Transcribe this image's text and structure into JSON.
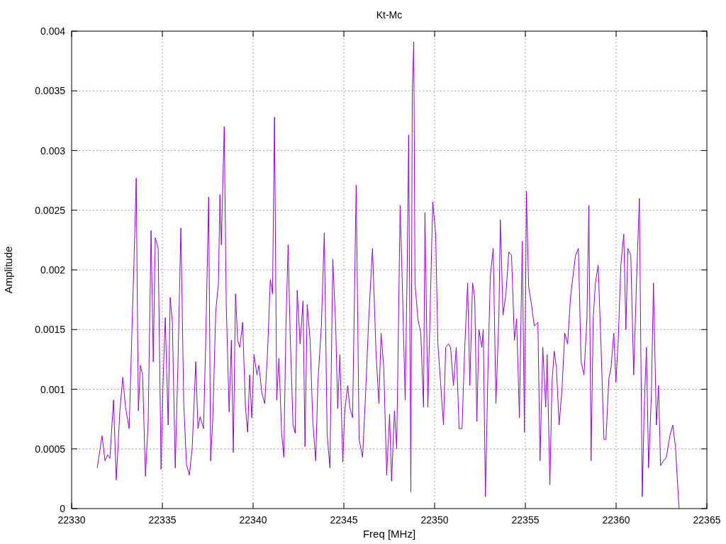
{
  "chart_data": {
    "type": "line",
    "title": "Kt-Mc",
    "xlabel": "Freq [MHz]",
    "ylabel": "Amplitude",
    "grid": true,
    "xlim": [
      22330,
      22365
    ],
    "ylim": [
      0,
      0.004
    ],
    "xticks": [
      22330,
      22335,
      22340,
      22345,
      22350,
      22355,
      22360,
      22365
    ],
    "yticks": [
      0,
      0.0005,
      0.001,
      0.0015,
      0.002,
      0.0025,
      0.003,
      0.0035,
      0.004
    ],
    "x": [
      22331.41,
      22331.68,
      22331.84,
      22331.99,
      22332.11,
      22332.31,
      22332.46,
      22332.66,
      22332.82,
      22332.97,
      22333.17,
      22333.32,
      22333.48,
      22333.56,
      22333.68,
      22333.79,
      22333.91,
      22334.07,
      22334.22,
      22334.38,
      22334.5,
      22334.61,
      22334.77,
      22334.93,
      22335.04,
      22335.16,
      22335.32,
      22335.43,
      22335.55,
      22335.71,
      22335.87,
      22336.02,
      22336.18,
      22336.33,
      22336.49,
      22336.65,
      22336.84,
      22336.96,
      22337.08,
      22337.27,
      22337.39,
      22337.55,
      22337.66,
      22337.78,
      22337.94,
      22338.09,
      22338.17,
      22338.25,
      22338.41,
      22338.52,
      22338.68,
      22338.8,
      22338.91,
      22339.03,
      22339.15,
      22339.27,
      22339.42,
      22339.58,
      22339.7,
      22339.81,
      22339.93,
      22340.05,
      22340.21,
      22340.32,
      22340.48,
      22340.64,
      22340.79,
      22340.95,
      22341.07,
      22341.18,
      22341.3,
      22341.42,
      22341.57,
      22341.69,
      22341.81,
      22341.93,
      22342.04,
      22342.2,
      22342.32,
      22342.43,
      22342.59,
      22342.75,
      22342.86,
      22342.98,
      22343.14,
      22343.29,
      22343.45,
      22343.57,
      22343.76,
      22343.92,
      22344.08,
      22344.23,
      22344.39,
      22344.55,
      22344.66,
      22344.78,
      22344.94,
      22345.05,
      22345.21,
      22345.33,
      22345.48,
      22345.68,
      22345.84,
      22346.03,
      22346.19,
      22346.38,
      22346.58,
      22346.77,
      22346.93,
      22347.05,
      22347.2,
      22347.36,
      22347.52,
      22347.63,
      22347.79,
      22347.91,
      22348.1,
      22348.22,
      22348.38,
      22348.49,
      22348.57,
      22348.69,
      22348.77,
      22348.85,
      22348.92,
      22349.08,
      22349.24,
      22349.39,
      22349.47,
      22349.63,
      22349.78,
      22349.9,
      22350.06,
      22350.18,
      22350.33,
      22350.49,
      22350.61,
      22350.76,
      22350.88,
      22351.04,
      22351.19,
      22351.35,
      22351.51,
      22351.66,
      22351.82,
      22351.94,
      22352.09,
      22352.21,
      22352.33,
      22352.44,
      22352.6,
      22352.68,
      22352.8,
      22352.95,
      22353.07,
      22353.23,
      22353.38,
      22353.54,
      22353.62,
      22353.77,
      22353.93,
      22354.09,
      22354.24,
      22354.4,
      22354.52,
      22354.67,
      22354.83,
      22354.95,
      22355.06,
      22355.18,
      22355.34,
      22355.49,
      22355.69,
      22355.81,
      22355.96,
      22356.12,
      22356.2,
      22356.35,
      22356.47,
      22356.59,
      22356.71,
      22356.86,
      22357.02,
      22357.17,
      22357.33,
      22357.49,
      22357.6,
      22357.76,
      22357.92,
      22358.07,
      22358.23,
      22358.39,
      22358.5,
      22358.62,
      22358.74,
      22358.86,
      22359.01,
      22359.17,
      22359.33,
      22359.44,
      22359.6,
      22359.72,
      22359.87,
      22359.99,
      22360.11,
      22360.26,
      22360.42,
      22360.54,
      22360.65,
      22360.81,
      22360.97,
      22361.12,
      22361.28,
      22361.44,
      22361.55,
      22361.67,
      22361.79,
      22361.94,
      22362.06,
      22362.22,
      22362.34,
      22362.45,
      22362.61,
      22362.77,
      22362.96,
      22363.12,
      22363.27,
      22363.47
    ],
    "series": [
      {
        "color": "#9400d3",
        "values": [
          0.00034,
          0.00061,
          0.0004,
          0.00045,
          0.00042,
          0.00091,
          0.00024,
          0.00082,
          0.0011,
          0.00085,
          0.00067,
          0.00147,
          0.0023,
          0.00277,
          0.00082,
          0.0012,
          0.00112,
          0.00027,
          0.00073,
          0.00233,
          0.00123,
          0.00227,
          0.00218,
          0.00033,
          0.00106,
          0.0016,
          0.0007,
          0.00177,
          0.00156,
          0.00034,
          0.00129,
          0.00235,
          0.00088,
          0.00037,
          0.00028,
          0.00052,
          0.00123,
          0.00067,
          0.00077,
          0.00067,
          0.00141,
          0.00261,
          0.0004,
          0.00076,
          0.00165,
          0.00189,
          0.00263,
          0.00221,
          0.0032,
          0.00171,
          0.00081,
          0.00141,
          0.00047,
          0.0018,
          0.00141,
          0.00135,
          0.00156,
          0.00085,
          0.00064,
          0.00112,
          0.00076,
          0.00129,
          0.00112,
          0.0012,
          0.00097,
          0.00088,
          0.00129,
          0.00192,
          0.0018,
          0.00328,
          0.00091,
          0.00126,
          0.00064,
          0.00043,
          0.00153,
          0.00221,
          0.00147,
          0.0007,
          0.00063,
          0.00183,
          0.00138,
          0.00174,
          0.00052,
          0.00171,
          0.00141,
          0.00073,
          0.0004,
          0.00106,
          0.00153,
          0.00231,
          0.00063,
          0.00034,
          0.00209,
          0.00153,
          0.00084,
          0.00129,
          0.00039,
          0.00082,
          0.00103,
          0.00085,
          0.00076,
          0.00271,
          0.00058,
          0.00043,
          0.00094,
          0.00162,
          0.00218,
          0.00132,
          0.00088,
          0.00147,
          0.00118,
          0.00028,
          0.00079,
          0.00023,
          0.00082,
          0.0005,
          0.00254,
          0.00189,
          0.00091,
          0.00201,
          0.00313,
          0.00014,
          0.00349,
          0.00391,
          0.00188,
          0.00159,
          0.00147,
          0.00085,
          0.00248,
          0.00085,
          0.00183,
          0.00257,
          0.0023,
          0.00138,
          0.00106,
          0.0007,
          0.00135,
          0.00138,
          0.00135,
          0.00103,
          0.00135,
          0.00067,
          0.00067,
          0.00135,
          0.00189,
          0.00103,
          0.00189,
          0.00177,
          0.00073,
          0.0015,
          0.00135,
          0.0015,
          0.0001,
          0.00123,
          0.00195,
          0.00218,
          0.00088,
          0.00159,
          0.00242,
          0.00162,
          0.0018,
          0.00215,
          0.00212,
          0.00141,
          0.00159,
          0.00076,
          0.00224,
          0.00064,
          0.00266,
          0.00186,
          0.00171,
          0.00153,
          0.00156,
          0.0004,
          0.00135,
          0.00085,
          0.00129,
          0.0002,
          0.00106,
          0.00132,
          0.00118,
          0.0007,
          0.001,
          0.00147,
          0.00138,
          0.00177,
          0.00192,
          0.00212,
          0.00218,
          0.00123,
          0.00112,
          0.00159,
          0.00254,
          0.0004,
          0.00159,
          0.00189,
          0.00204,
          0.00135,
          0.00058,
          0.00058,
          0.00109,
          0.00118,
          0.00147,
          0.00106,
          0.00138,
          0.00204,
          0.0023,
          0.0015,
          0.00218,
          0.00212,
          0.00112,
          0.00189,
          0.0026,
          0.0001,
          0.00085,
          0.00135,
          0.00034,
          0.00094,
          0.00189,
          0.0007,
          0.00103,
          0.00036,
          0.0004,
          0.00043,
          0.00061,
          0.0007,
          0.00052,
          0
        ]
      }
    ]
  }
}
